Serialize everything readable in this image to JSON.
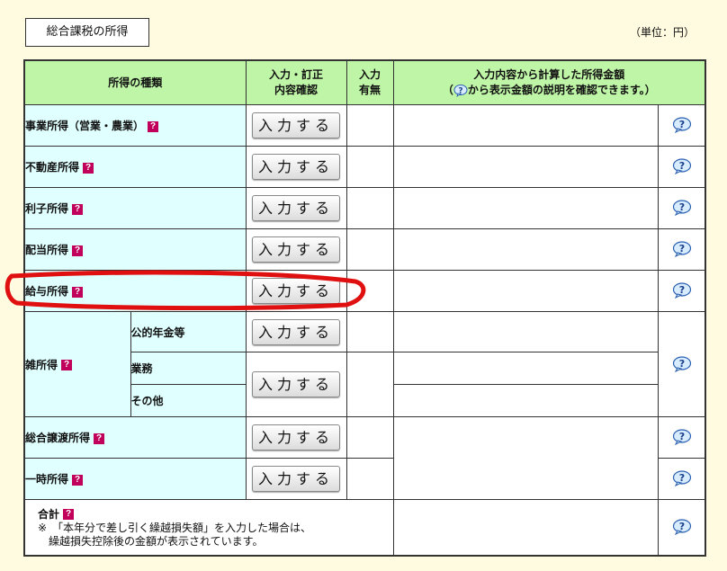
{
  "title": "総合課税の所得",
  "unit": "（単位：円）",
  "headers": {
    "type": "所得の種類",
    "input_confirm_1": "入力・訂正",
    "input_confirm_2": "内容確認",
    "input_status_1": "入力",
    "input_status_2": "有無",
    "computed_1": "入力内容から計算した所得金額",
    "computed_2_pre": "（",
    "computed_2_post": "から表示金額の説明を確認できます。）"
  },
  "input_button_label": "入力する",
  "qmark": "?",
  "rows": {
    "business": "事業所得（営業・農業）",
    "real_estate": "不動産所得",
    "interest": "利子所得",
    "dividend": "配当所得",
    "salary": "給与所得",
    "misc": "雑所得",
    "misc_pension": "公的年金等",
    "misc_business": "業務",
    "misc_other": "その他",
    "capital_gains": "総合譲渡所得",
    "occasional": "一時所得",
    "total": "合計",
    "total_note_1": "※　「本年分で差し引く繰越損失額」を入力した場合は、",
    "total_note_2": "　繰越損失控除後の金額が表示されています。"
  },
  "colors": {
    "header_bg": "#bff5a6",
    "label_bg": "#e0ffff",
    "page_bg": "#fffbe0",
    "badge": "#c0005a",
    "annotation": "#e01010"
  }
}
